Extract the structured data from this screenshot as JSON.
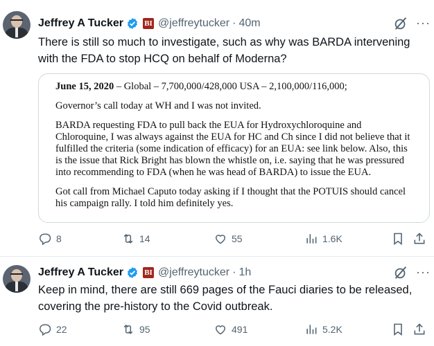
{
  "tweets": [
    {
      "author_name": "Jeffrey A Tucker",
      "handle": "@jeffreytucker",
      "separator": "·",
      "time": "40m",
      "badge_text": "BI",
      "text": "There is still so much to investigate, such as why was BARDA intervening with the FDA to stop HCQ on behalf of Moderna?",
      "attachment": {
        "date": "June 15, 2020",
        "heading_rest": " – Global – 7,700,000/428,000  USA – 2,100,000/116,000;",
        "paragraphs": [
          "Governor’s call today at WH and I was not invited.",
          "BARDA requesting FDA to pull back the EUA for Hydroxychloroquine and Chloroquine,   I was always against the EUA for HC and Ch since I did not believe that it fulfilled the criteria (some indication of efficacy) for an EUA:  see link below.   Also, this is the issue that Rick Bright has blown the whistle on, i.e. saying that he was pressured into recommending to FDA (when he was head of BARDA) to issue the EUA.",
          "Got call from Michael Caputo today asking if I thought that the POTUIS should cancel his campaign rally.   I told him definitely yes."
        ]
      },
      "stats": {
        "replies": "8",
        "reposts": "14",
        "likes": "55",
        "views": "1.6K"
      }
    },
    {
      "author_name": "Jeffrey A Tucker",
      "handle": "@jeffreytucker",
      "separator": "·",
      "time": "1h",
      "badge_text": "BI",
      "text": "Keep in mind, there are still 669 pages of the Fauci diaries to be released, covering the pre-history to the Covid outbreak.",
      "stats": {
        "replies": "22",
        "reposts": "95",
        "likes": "491",
        "views": "5.2K"
      }
    }
  ],
  "icons": {
    "verified": "verified-badge-icon",
    "affiliate": "brownstone-affiliate-icon",
    "grok": "grok-icon",
    "more": "more-icon",
    "reply": "reply-icon",
    "repost": "repost-icon",
    "like": "heart-icon",
    "views": "views-icon",
    "bookmark": "bookmark-icon",
    "share": "share-icon"
  },
  "colors": {
    "verified": "#1d9bf0",
    "affiliate": "#a0281e",
    "muted": "#536471",
    "text": "#0f1419"
  }
}
